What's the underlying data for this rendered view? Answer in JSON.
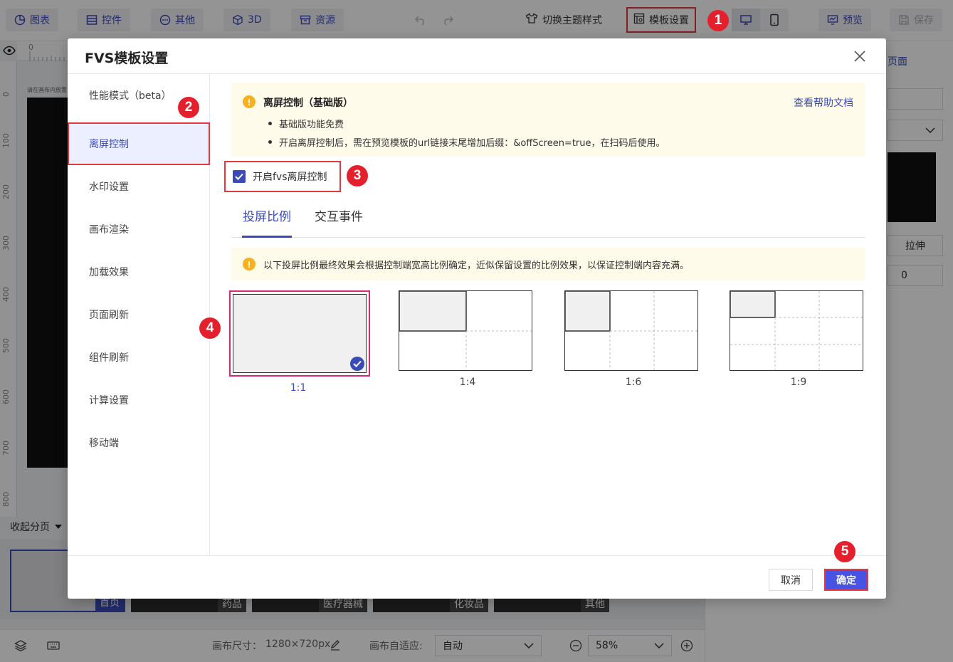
{
  "toolbar": {
    "items": [
      {
        "label": "图表",
        "icon": "pie-chart-icon"
      },
      {
        "label": "控件",
        "icon": "widget-icon"
      },
      {
        "label": "其他",
        "icon": "more-circle-icon"
      },
      {
        "label": "3D",
        "icon": "cube-icon"
      },
      {
        "label": "资源",
        "icon": "archive-icon"
      }
    ],
    "theme_label": "切换主题样式",
    "template_settings_label": "模板设置",
    "preview_label": "预览",
    "save_label": "保存"
  },
  "background": {
    "ruler_ticks": [
      "0",
      "100",
      "200",
      "300",
      "400",
      "500",
      "600",
      "700",
      "800"
    ],
    "canvas_caption": "请在画布内放置",
    "collapse_label": "收起分页",
    "pages": [
      "首页",
      "药品",
      "医疗器械",
      "化妆品",
      "其他"
    ],
    "status": {
      "canvas_size_label": "画布尺寸：",
      "canvas_size_value": "1280×720px",
      "adapt_label": "画布自适应:",
      "adapt_value": "自动",
      "zoom_value": "58%"
    },
    "right_panel": {
      "tab_fragment": "页面",
      "stretch_label": "拉伸",
      "number_value": "0"
    }
  },
  "modal": {
    "title": "FVS模板设置",
    "side_items": [
      "性能模式（beta）",
      "离屏控制",
      "水印设置",
      "画布渲染",
      "加载效果",
      "页面刷新",
      "组件刷新",
      "计算设置",
      "移动端"
    ],
    "notice": {
      "title": "离屏控制（基础版）",
      "link": "查看帮助文档",
      "bullets": [
        "基础版功能免费",
        "开启离屏控制后，需在预览模板的url链接末尾增加后缀：&offScreen=true，在扫码后使用。"
      ]
    },
    "checkbox_label": "开启fvs离屏控制",
    "tabs": [
      "投屏比例",
      "交互事件"
    ],
    "tip": "以下投屏比例最终效果会根据控制端宽高比例确定，近似保留设置的比例效果，以保证控制端内容充满。",
    "ratios": [
      "1:1",
      "1:4",
      "1:6",
      "1:9"
    ],
    "cancel_label": "取消",
    "ok_label": "确定"
  },
  "callouts": [
    "1",
    "2",
    "3",
    "4",
    "5"
  ],
  "colors": {
    "accent": "#3a4bb8",
    "callout": "#e5202d",
    "highlight": "#e2383f",
    "primary_button": "#4653e3"
  }
}
